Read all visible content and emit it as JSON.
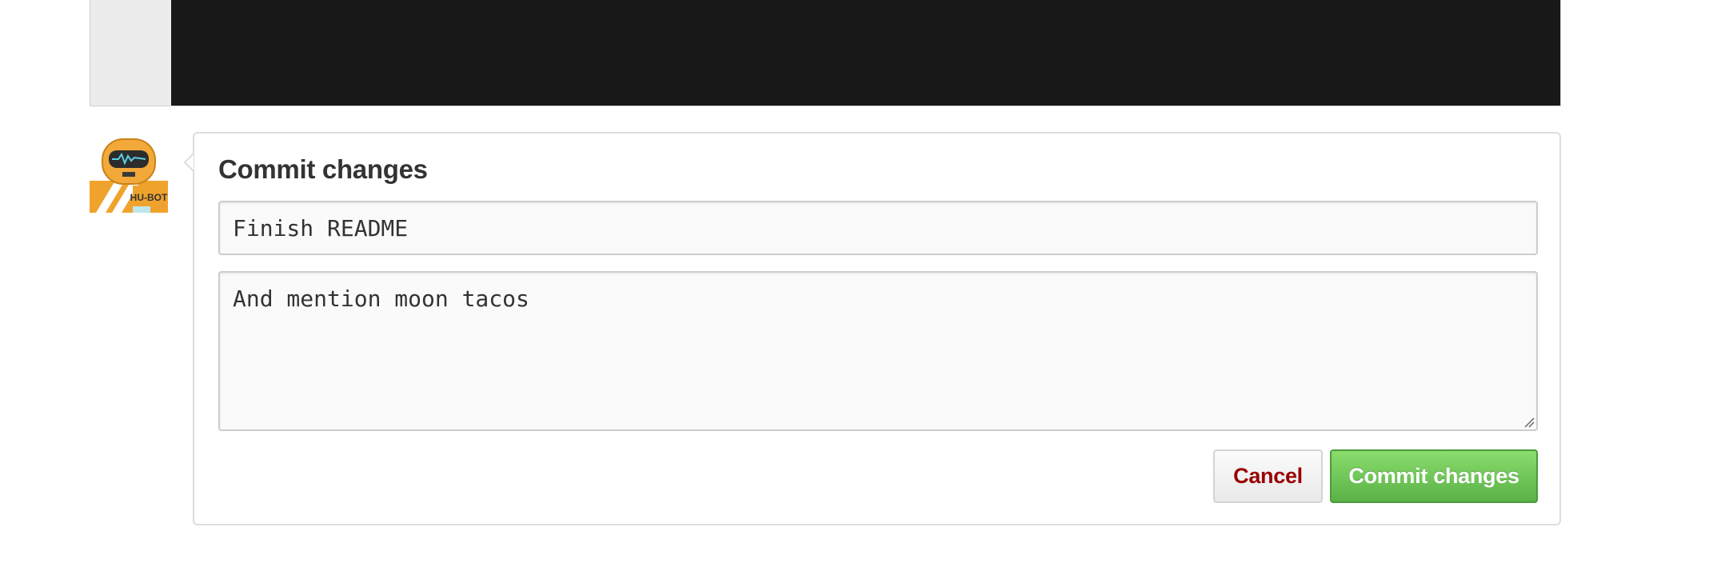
{
  "commit_form": {
    "title": "Commit changes",
    "summary_value": "Finish README",
    "description_value": "And mention moon tacos",
    "cancel_label": "Cancel",
    "submit_label": "Commit changes"
  },
  "avatar": {
    "badge_text": "HU-BOT",
    "icon": "hubot-avatar-icon"
  },
  "colors": {
    "code_background": "#181818",
    "gutter_background": "#ececec",
    "cancel_text": "#990000",
    "commit_green": "#6cc644"
  }
}
